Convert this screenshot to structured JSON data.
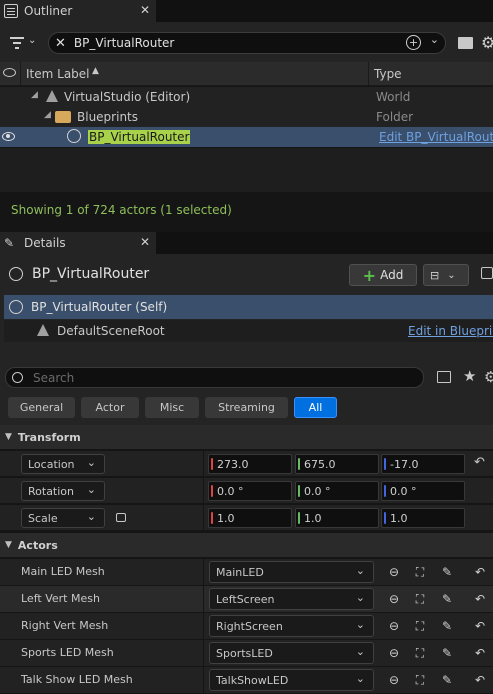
{
  "outliner": {
    "tab_title": "Outliner",
    "search_value": "BP_VirtualRouter",
    "col_label": "Item Label",
    "col_type": "Type",
    "rows": [
      {
        "label": "VirtualStudio (Editor)",
        "type": "World"
      },
      {
        "label": "Blueprints",
        "type": "Folder"
      },
      {
        "label": "BP_VirtualRouter",
        "type": "Edit BP_VirtualRoute"
      }
    ],
    "status": "Showing 1 of 724 actors (1 selected)"
  },
  "details": {
    "tab_title": "Details",
    "actor_name": "BP_VirtualRouter",
    "add_label": "Add",
    "self_label": "BP_VirtualRouter (Self)",
    "root_label": "DefaultSceneRoot",
    "edit_bp_label": "Edit in Blueprint",
    "search_placeholder": "Search",
    "filters": [
      "General",
      "Actor",
      "Misc",
      "Streaming",
      "All"
    ],
    "active_filter": "All",
    "transform": {
      "header": "Transform",
      "rows": [
        {
          "label": "Location",
          "x": "273.0",
          "y": "675.0",
          "z": "-17.0"
        },
        {
          "label": "Rotation",
          "x": "0.0 °",
          "y": "0.0 °",
          "z": "0.0 °"
        },
        {
          "label": "Scale",
          "x": "1.0",
          "y": "1.0",
          "z": "1.0"
        }
      ]
    },
    "actors": {
      "header": "Actors",
      "rows": [
        {
          "label": "Main LED Mesh",
          "value": "MainLED"
        },
        {
          "label": "Left Vert Mesh",
          "value": "LeftScreen"
        },
        {
          "label": "Right Vert Mesh",
          "value": "RightScreen"
        },
        {
          "label": "Sports LED Mesh",
          "value": "SportsLED"
        },
        {
          "label": "Talk Show LED Mesh",
          "value": "TalkShowLED"
        }
      ]
    }
  },
  "colors": {
    "accent": "#0070e0",
    "status_green": "#8fbf5a",
    "highlight": "#a8d24a",
    "selected_row": "#3a4f6b"
  }
}
